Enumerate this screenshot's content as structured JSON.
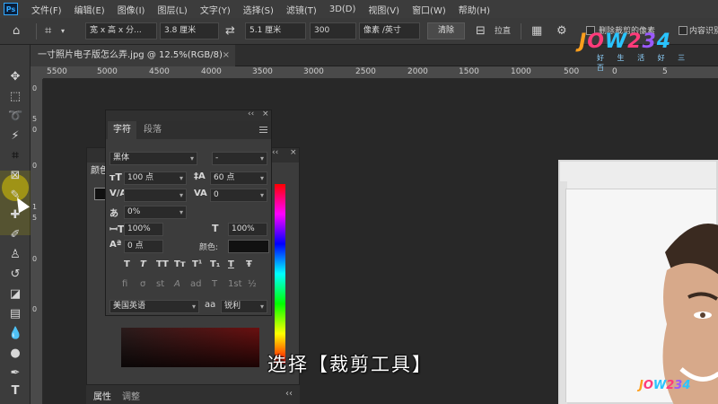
{
  "app": {
    "logo": "Ps"
  },
  "menu": [
    "文件(F)",
    "编辑(E)",
    "图像(I)",
    "图层(L)",
    "文字(Y)",
    "选择(S)",
    "滤镜(T)",
    "3D(D)",
    "视图(V)",
    "窗口(W)",
    "帮助(H)"
  ],
  "options": {
    "ratio_select": "宽 x 高 x 分...",
    "width": "3.8 厘米",
    "height": "5.1 厘米",
    "resolution": "300",
    "unit_select": "像素 /英寸",
    "clear_button": "清除",
    "straighten_label": "拉直",
    "delete_cropped_label": "删除裁剪的像素",
    "content_aware_label": "内容识别"
  },
  "watermark": {
    "logo_text": "JOW234",
    "slogan": "好 生 活 好 三 百"
  },
  "document": {
    "tab_title": "一寸照片电子版怎么弄.jpg @ 12.5%(RGB/8)",
    "close": "×"
  },
  "ruler": {
    "h_ticks": [
      "5500",
      "5000",
      "4500",
      "4000",
      "3500",
      "3000",
      "2500",
      "2000",
      "1500",
      "1000",
      "500",
      "0",
      "5"
    ],
    "v_ticks": [
      "0",
      "5",
      "0",
      "0",
      "1",
      "5",
      "0",
      "0"
    ]
  },
  "color_panel": {
    "tab": "颜色",
    "close": "×",
    "collapse": "‹‹",
    "bottom_tabs": [
      "属性",
      "调整"
    ]
  },
  "character_panel": {
    "collapse": "‹‹",
    "close": "×",
    "tabs": [
      "字符",
      "段落"
    ],
    "font_family": "黑体",
    "font_style": "-",
    "font_size": "100 点",
    "leading": "60 点",
    "kerning": "",
    "tracking": "0",
    "scale_pct": "0%",
    "vertical_scale": "100%",
    "horizontal_scale": "100%",
    "baseline_shift": "0 点",
    "color_label": "颜色:",
    "language": "美国英语",
    "aa_icon": "aa",
    "antialias": "锐利",
    "format_buttons": [
      "T",
      "T",
      "TT",
      "Tт",
      "T¹",
      "T₁",
      "T",
      "Ŧ"
    ],
    "opentype_buttons": [
      "fi",
      "σ",
      "st",
      "A",
      "ad",
      "T",
      "1st",
      "½"
    ]
  },
  "subtitle": "选择【裁剪工具】",
  "corner_watermark": "JOW234",
  "colors": {
    "accent": "#31a8ff",
    "highlight": "#d8c800"
  }
}
